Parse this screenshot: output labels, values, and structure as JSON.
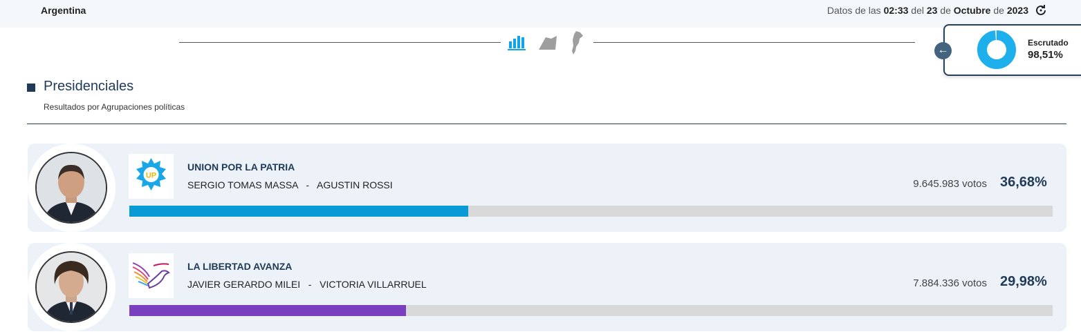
{
  "header": {
    "country": "Argentina",
    "datos_prefix": "Datos de las",
    "time": "02:33",
    "del": "del",
    "day": "23",
    "de1": "de",
    "month": "Octubre",
    "de2": "de",
    "year": "2023",
    "refresh_icon": "refresh-icon"
  },
  "nav": {
    "icons": [
      "bar-chart-icon",
      "map-region-icon",
      "argentina-map-icon"
    ],
    "active_color": "#0ea5e9"
  },
  "escrutado": {
    "label": "Escrutado",
    "value": "98,51%",
    "fraction": 0.9851,
    "color": "#1eb0ec",
    "back_icon": "arrow-left-icon"
  },
  "section": {
    "title": "Presidenciales",
    "subtitle": "Resultados por Agrupaciones políticas"
  },
  "results": [
    {
      "party": "UNION POR LA PATRIA",
      "candidates": "SERGIO TOMAS MASSA   -   AGUSTIN ROSSI",
      "votes": "9.645.983 votos",
      "percent": "36,68%",
      "fraction": 0.3668,
      "color": "#0a9bd6",
      "logo_text": "UP"
    },
    {
      "party": "LA LIBERTAD AVANZA",
      "candidates": "JAVIER GERARDO MILEI   -   VICTORIA VILLARRUEL",
      "votes": "7.884.336 votos",
      "percent": "29,98%",
      "fraction": 0.2998,
      "color": "#7a3fbf"
    }
  ]
}
